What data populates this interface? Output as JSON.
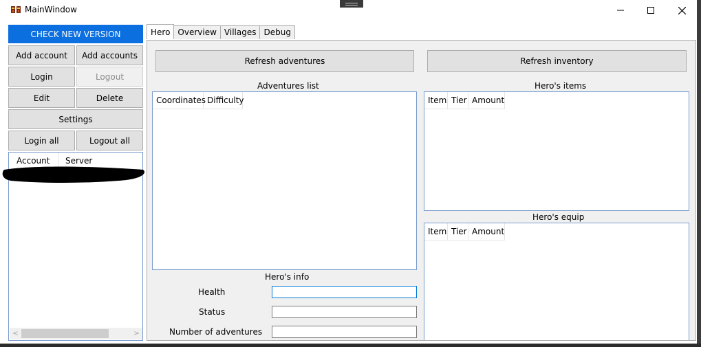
{
  "window": {
    "title": "MainWindow",
    "minimize_glyph": "─",
    "maximize_glyph": "☐",
    "close_glyph": "✕"
  },
  "sidebar": {
    "check_version": "CHECK NEW VERSION",
    "add_account": "Add account",
    "add_accounts": "Add accounts",
    "login": "Login",
    "logout": "Logout",
    "edit": "Edit",
    "delete": "Delete",
    "settings": "Settings",
    "login_all": "Login all",
    "logout_all": "Logout all",
    "accounts_table": {
      "columns": [
        "Account",
        "Server"
      ]
    },
    "scroll_left": "<",
    "scroll_right": ">"
  },
  "tabs": [
    "Hero",
    "Overview",
    "Villages",
    "Debug"
  ],
  "hero": {
    "refresh_adventures": "Refresh adventures",
    "refresh_inventory": "Refresh inventory",
    "adventures_title": "Adventures list",
    "adventures_columns": [
      "Coordinates",
      "Difficulty"
    ],
    "items_title": "Hero's items",
    "items_columns": [
      "Item",
      "Tier",
      "Amount"
    ],
    "equip_title": "Hero's equip",
    "equip_columns": [
      "Item",
      "Tier",
      "Amount"
    ],
    "info_title": "Hero's info",
    "health_label": "Health",
    "status_label": "Status",
    "num_adventures_label": "Number of adventures",
    "health_value": "",
    "status_value": "",
    "num_adventures_value": ""
  },
  "colors": {
    "accent": "#0b6fe0",
    "list_border": "#7a9ccf",
    "panel_bg": "#f0f0f0"
  },
  "icons": [
    "app-icon",
    "minimize-icon",
    "maximize-icon",
    "close-icon"
  ]
}
